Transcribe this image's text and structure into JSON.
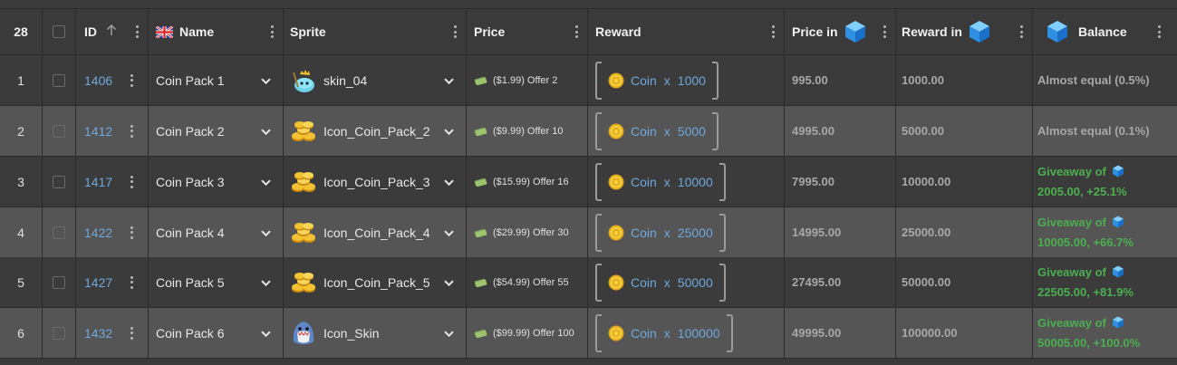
{
  "header": {
    "row_count": "28",
    "id": "ID",
    "name": "Name",
    "sprite": "Sprite",
    "price": "Price",
    "reward": "Reward",
    "price_in": "Price in",
    "reward_in": "Reward in",
    "balance": "Balance",
    "sort_icon": "arrow-up-icon",
    "flag_icon": "uk-flag-icon",
    "cube_icon": "blue-cube-icon"
  },
  "colors": {
    "link": "#6fa8dc",
    "balance_green": "#4caf50",
    "balance_grey": "#a8a8a8",
    "row_dark": "#3b3b3b",
    "row_light": "#555555"
  },
  "rows": [
    {
      "num": "1",
      "id": "1406",
      "name": "Coin Pack 1",
      "sprite": "skin_04",
      "sprite_icon": "slime-skin-icon",
      "price": "($1.99) Offer 2",
      "reward_item": "Coin",
      "reward_x": "x",
      "reward_qty": "1000",
      "price_in": "995.00",
      "reward_in": "1000.00",
      "balance_type": "grey",
      "balance": "Almost equal (0.5%)"
    },
    {
      "num": "2",
      "id": "1412",
      "name": "Coin Pack 2",
      "sprite": "Icon_Coin_Pack_2",
      "sprite_icon": "coin-pile-icon",
      "price": "($9.99) Offer 10",
      "reward_item": "Coin",
      "reward_x": "x",
      "reward_qty": "5000",
      "price_in": "4995.00",
      "reward_in": "5000.00",
      "balance_type": "grey",
      "balance": "Almost equal (0.1%)"
    },
    {
      "num": "3",
      "id": "1417",
      "name": "Coin Pack 3",
      "sprite": "Icon_Coin_Pack_3",
      "sprite_icon": "coin-pile-icon",
      "price": "($15.99) Offer 16",
      "reward_item": "Coin",
      "reward_x": "x",
      "reward_qty": "10000",
      "price_in": "7995.00",
      "reward_in": "10000.00",
      "balance_type": "green",
      "balance_line1": "Giveaway of",
      "balance_line2": "2005.00, +25.1%"
    },
    {
      "num": "4",
      "id": "1422",
      "name": "Coin Pack 4",
      "sprite": "Icon_Coin_Pack_4",
      "sprite_icon": "coin-pile-icon",
      "price": "($29.99) Offer 30",
      "reward_item": "Coin",
      "reward_x": "x",
      "reward_qty": "25000",
      "price_in": "14995.00",
      "reward_in": "25000.00",
      "balance_type": "green",
      "balance_line1": "Giveaway of",
      "balance_line2": "10005.00, +66.7%"
    },
    {
      "num": "5",
      "id": "1427",
      "name": "Coin Pack 5",
      "sprite": "Icon_Coin_Pack_5",
      "sprite_icon": "coin-pile-icon",
      "price": "($54.99) Offer 55",
      "reward_item": "Coin",
      "reward_x": "x",
      "reward_qty": "50000",
      "price_in": "27495.00",
      "reward_in": "50000.00",
      "balance_type": "green",
      "balance_line1": "Giveaway of",
      "balance_line2": "22505.00, +81.9%"
    },
    {
      "num": "6",
      "id": "1432",
      "name": "Coin Pack 6",
      "sprite": "Icon_Skin",
      "sprite_icon": "shark-skin-icon",
      "price": "($99.99) Offer 100",
      "reward_item": "Coin",
      "reward_x": "x",
      "reward_qty": "100000",
      "price_in": "49995.00",
      "reward_in": "100000.00",
      "balance_type": "green",
      "balance_line1": "Giveaway of",
      "balance_line2": "50005.00, +100.0%"
    }
  ]
}
